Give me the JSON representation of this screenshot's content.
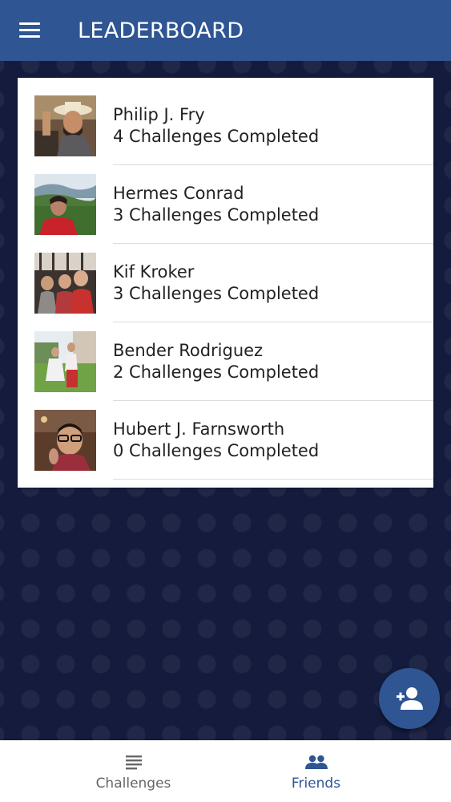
{
  "appbar": {
    "title": "LEADERBOARD",
    "menu_icon": "hamburger-menu-icon",
    "background": "#2f5593"
  },
  "leaderboard": [
    {
      "name": "Philip J. Fry",
      "challenges": "4 Challenges Completed"
    },
    {
      "name": "Hermes Conrad",
      "challenges": "3 Challenges Completed"
    },
    {
      "name": "Kif Kroker",
      "challenges": "3 Challenges Completed"
    },
    {
      "name": "Bender Rodriguez",
      "challenges": "2 Challenges Completed"
    },
    {
      "name": "Hubert J. Farnsworth",
      "challenges": "0 Challenges Completed"
    }
  ],
  "fab": {
    "icon": "add-person-icon",
    "color": "#2f5593"
  },
  "bottom_nav": {
    "items": [
      {
        "label": "Challenges",
        "icon": "list-icon",
        "active": false,
        "color": "#666666"
      },
      {
        "label": "Friends",
        "icon": "people-icon",
        "active": true,
        "color": "#2f5593"
      }
    ]
  },
  "colors": {
    "background": "#141b3d",
    "card": "#ffffff",
    "accent": "#2f5593"
  }
}
